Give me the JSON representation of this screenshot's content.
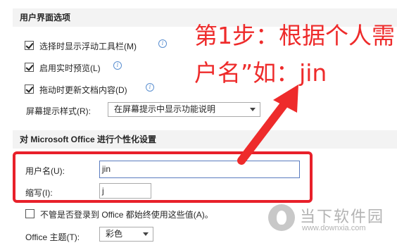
{
  "ui_options": {
    "header": "用户界面选项",
    "options": [
      {
        "label": "选择时显示浮动工具栏(M)",
        "checked": true
      },
      {
        "label": "启用实时预览(L)",
        "checked": true
      },
      {
        "label": "拖动时更新文档内容(D)",
        "checked": true
      }
    ],
    "screentip_label": "屏幕提示样式(R):",
    "screentip_value": "在屏幕提示中显示功能说明"
  },
  "personalize": {
    "header": "对 Microsoft Office 进行个性化设置",
    "username_label": "用户名(U):",
    "username_value": "jin",
    "initials_label": "缩写(I):",
    "initials_value": "j",
    "always_use_label": "不管是否登录到 Office 都始终使用这些值(A)。",
    "always_use_checked": false,
    "theme_label": "Office 主题(T):",
    "theme_value": "彩色"
  },
  "annotation": {
    "line1": "第1步：根据个人需",
    "line2": "户名”如：jin",
    "color": "#ee2b2b"
  },
  "watermark": {
    "name": "当下软件园",
    "url": "www.downxia.com"
  },
  "icons": {
    "info": "info-icon",
    "dropdown": "chevron-down-icon",
    "arrow": "red-arrow-icon",
    "logo": "downxia-logo-icon"
  }
}
